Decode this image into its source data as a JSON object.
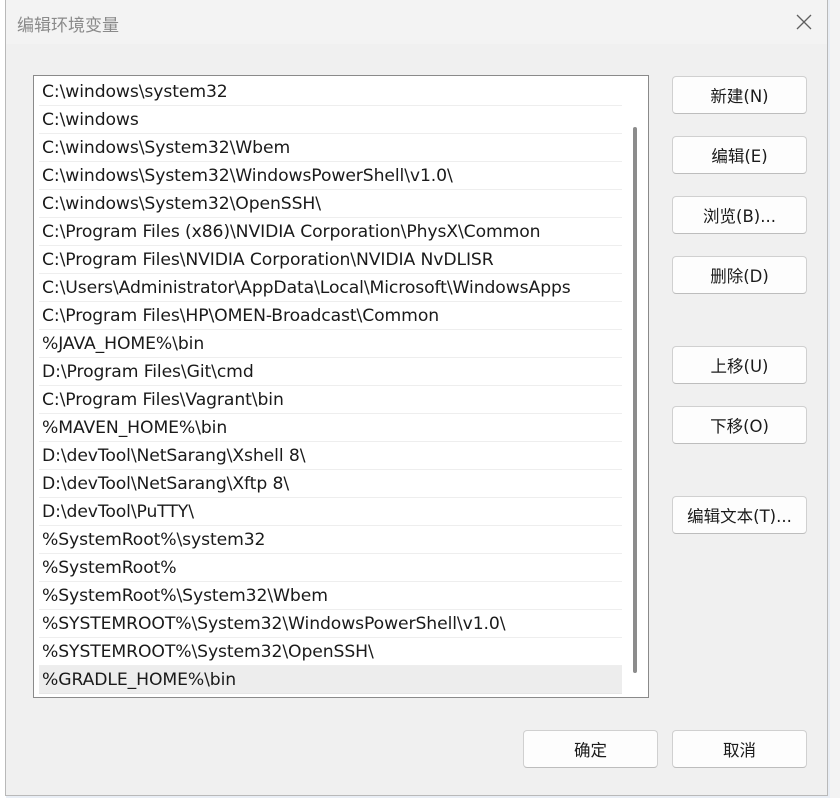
{
  "dialog": {
    "title": "编辑环境变量"
  },
  "path_list": {
    "items": [
      "C:\\windows\\system32",
      "C:\\windows",
      "C:\\windows\\System32\\Wbem",
      "C:\\windows\\System32\\WindowsPowerShell\\v1.0\\",
      "C:\\windows\\System32\\OpenSSH\\",
      "C:\\Program Files (x86)\\NVIDIA Corporation\\PhysX\\Common",
      "C:\\Program Files\\NVIDIA Corporation\\NVIDIA NvDLISR",
      "C:\\Users\\Administrator\\AppData\\Local\\Microsoft\\WindowsApps",
      "C:\\Program Files\\HP\\OMEN-Broadcast\\Common",
      "%JAVA_HOME%\\bin",
      "D:\\Program Files\\Git\\cmd",
      "C:\\Program Files\\Vagrant\\bin",
      "%MAVEN_HOME%\\bin",
      "D:\\devTool\\NetSarang\\Xshell 8\\",
      "D:\\devTool\\NetSarang\\Xftp 8\\",
      "D:\\devTool\\PuTTY\\",
      "%SystemRoot%\\system32",
      "%SystemRoot%",
      "%SystemRoot%\\System32\\Wbem",
      "%SYSTEMROOT%\\System32\\WindowsPowerShell\\v1.0\\",
      "%SYSTEMROOT%\\System32\\OpenSSH\\",
      "%GRADLE_HOME%\\bin"
    ],
    "selected_index": 21
  },
  "buttons": {
    "new": "新建(N)",
    "edit": "编辑(E)",
    "browse": "浏览(B)...",
    "delete": "删除(D)",
    "move_up": "上移(U)",
    "move_down": "下移(O)",
    "edit_text": "编辑文本(T)...",
    "ok": "确定",
    "cancel": "取消"
  },
  "icons": {
    "close": "close-icon"
  }
}
